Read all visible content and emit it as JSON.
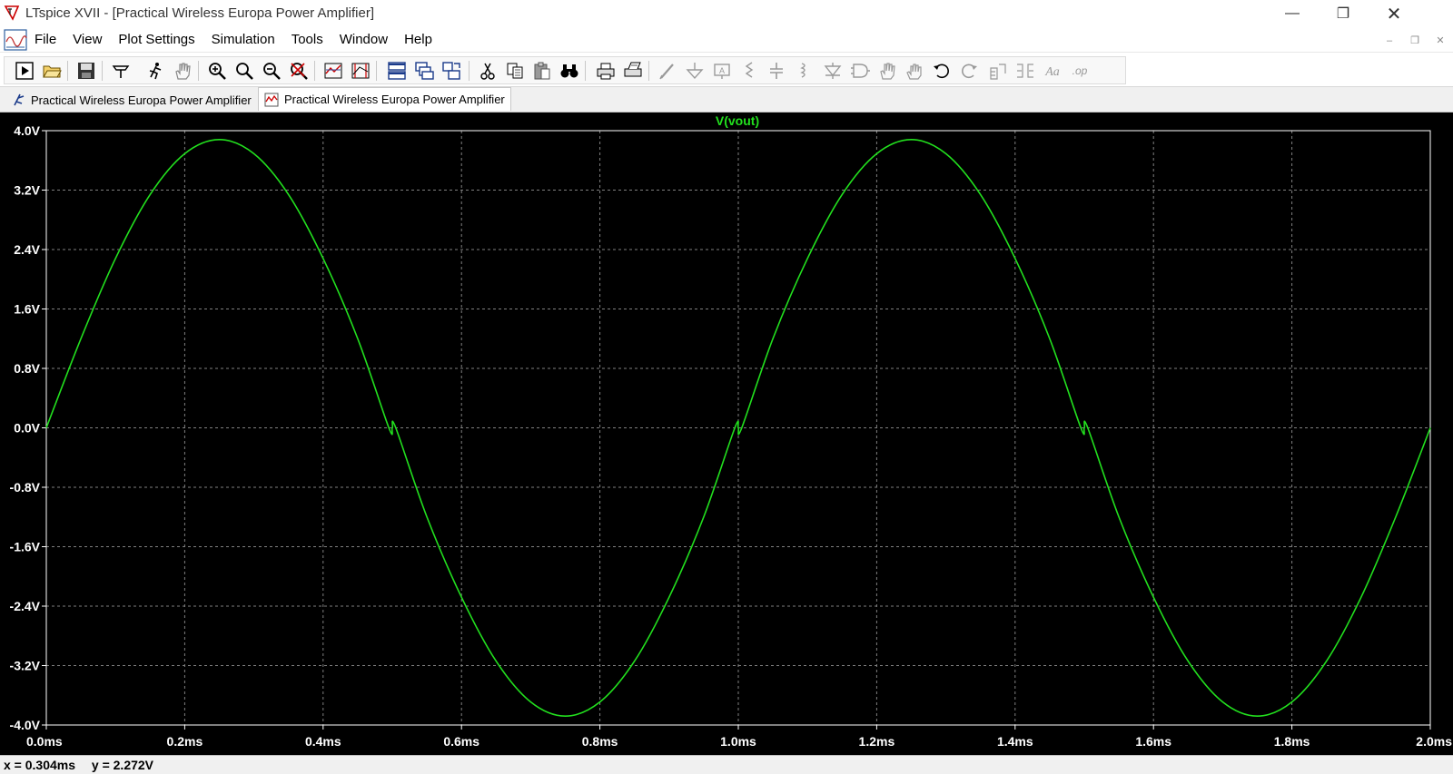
{
  "window": {
    "title": "LTspice XVII - [Practical Wireless Europa Power Amplifier]"
  },
  "menu": {
    "items": [
      "File",
      "View",
      "Plot Settings",
      "Simulation",
      "Tools",
      "Window",
      "Help"
    ]
  },
  "toolbar": {
    "icons": [
      "run-icon",
      "open-icon",
      "save-icon",
      "control-panel-icon",
      "halt-icon",
      "pan-icon",
      "zoom-in-icon",
      "zoom-area-icon",
      "zoom-out-icon",
      "zoom-fit-icon",
      "autorange-icon",
      "plot-icon",
      "tile-horizontal-icon",
      "cascade-icon",
      "tile-vertical-icon",
      "cut-icon",
      "copy-icon",
      "paste-icon",
      "find-icon",
      "print-icon",
      "print-setup-icon",
      "draw-wire-icon",
      "ground-icon",
      "label-net-icon",
      "resistor-icon",
      "capacitor-icon",
      "inductor-icon",
      "diode-icon",
      "component-icon",
      "move-icon",
      "drag-icon",
      "undo-icon",
      "redo-icon",
      "rotate-icon",
      "mirror-icon",
      "text-icon",
      "spice-directive-icon"
    ]
  },
  "tabs": [
    {
      "label": "Practical Wireless Europa Power Amplifier",
      "icon": "schematic-icon",
      "active": false
    },
    {
      "label": "Practical Wireless Europa Power Amplifier",
      "icon": "waveform-icon",
      "active": true
    }
  ],
  "plot": {
    "trace_label": "V(vout)"
  },
  "chart_data": {
    "type": "line",
    "title": "V(vout)",
    "xlabel": "",
    "ylabel": "",
    "xlim": [
      0,
      2.0
    ],
    "ylim": [
      -4.0,
      4.0
    ],
    "x_ticks": [
      "0.0ms",
      "0.2ms",
      "0.4ms",
      "0.6ms",
      "0.8ms",
      "1.0ms",
      "1.2ms",
      "1.4ms",
      "1.6ms",
      "1.8ms",
      "2.0ms"
    ],
    "y_ticks": [
      "4.0V",
      "3.2V",
      "2.4V",
      "1.6V",
      "0.8V",
      "0.0V",
      "-0.8V",
      "-1.6V",
      "-2.4V",
      "-3.2V",
      "-4.0V"
    ],
    "grid": true,
    "colors": {
      "trace": "#22e01e",
      "axis": "#ffffff",
      "grid": "#808080",
      "background": "#000000"
    },
    "series": [
      {
        "name": "V(vout)",
        "x": [
          0.0,
          0.05,
          0.1,
          0.15,
          0.2,
          0.25,
          0.3,
          0.35,
          0.4,
          0.45,
          0.495,
          0.5,
          0.505,
          0.55,
          0.6,
          0.65,
          0.7,
          0.75,
          0.8,
          0.85,
          0.9,
          0.95,
          0.995,
          1.0,
          1.005,
          1.05,
          1.1,
          1.15,
          1.2,
          1.25,
          1.3,
          1.35,
          1.4,
          1.45,
          1.495,
          1.5,
          1.505,
          1.55,
          1.6,
          1.65,
          1.7,
          1.75,
          1.8,
          1.85,
          1.9,
          1.95,
          2.0
        ],
        "values": [
          0.0,
          1.2,
          2.28,
          3.14,
          3.69,
          3.88,
          3.69,
          3.14,
          2.28,
          1.2,
          0.0,
          0.0,
          0.0,
          -1.2,
          -2.28,
          -3.14,
          -3.69,
          -3.88,
          -3.69,
          -3.14,
          -2.28,
          -1.2,
          0.0,
          0.0,
          0.0,
          1.2,
          2.28,
          3.14,
          3.69,
          3.88,
          3.69,
          3.14,
          2.28,
          1.2,
          0.0,
          0.0,
          0.0,
          -1.2,
          -2.28,
          -3.14,
          -3.69,
          -3.88,
          -3.69,
          -3.14,
          -2.28,
          -1.2,
          0.0
        ]
      }
    ]
  },
  "status": {
    "x_readout": "x = 0.304ms",
    "y_readout": "y = 2.272V"
  }
}
